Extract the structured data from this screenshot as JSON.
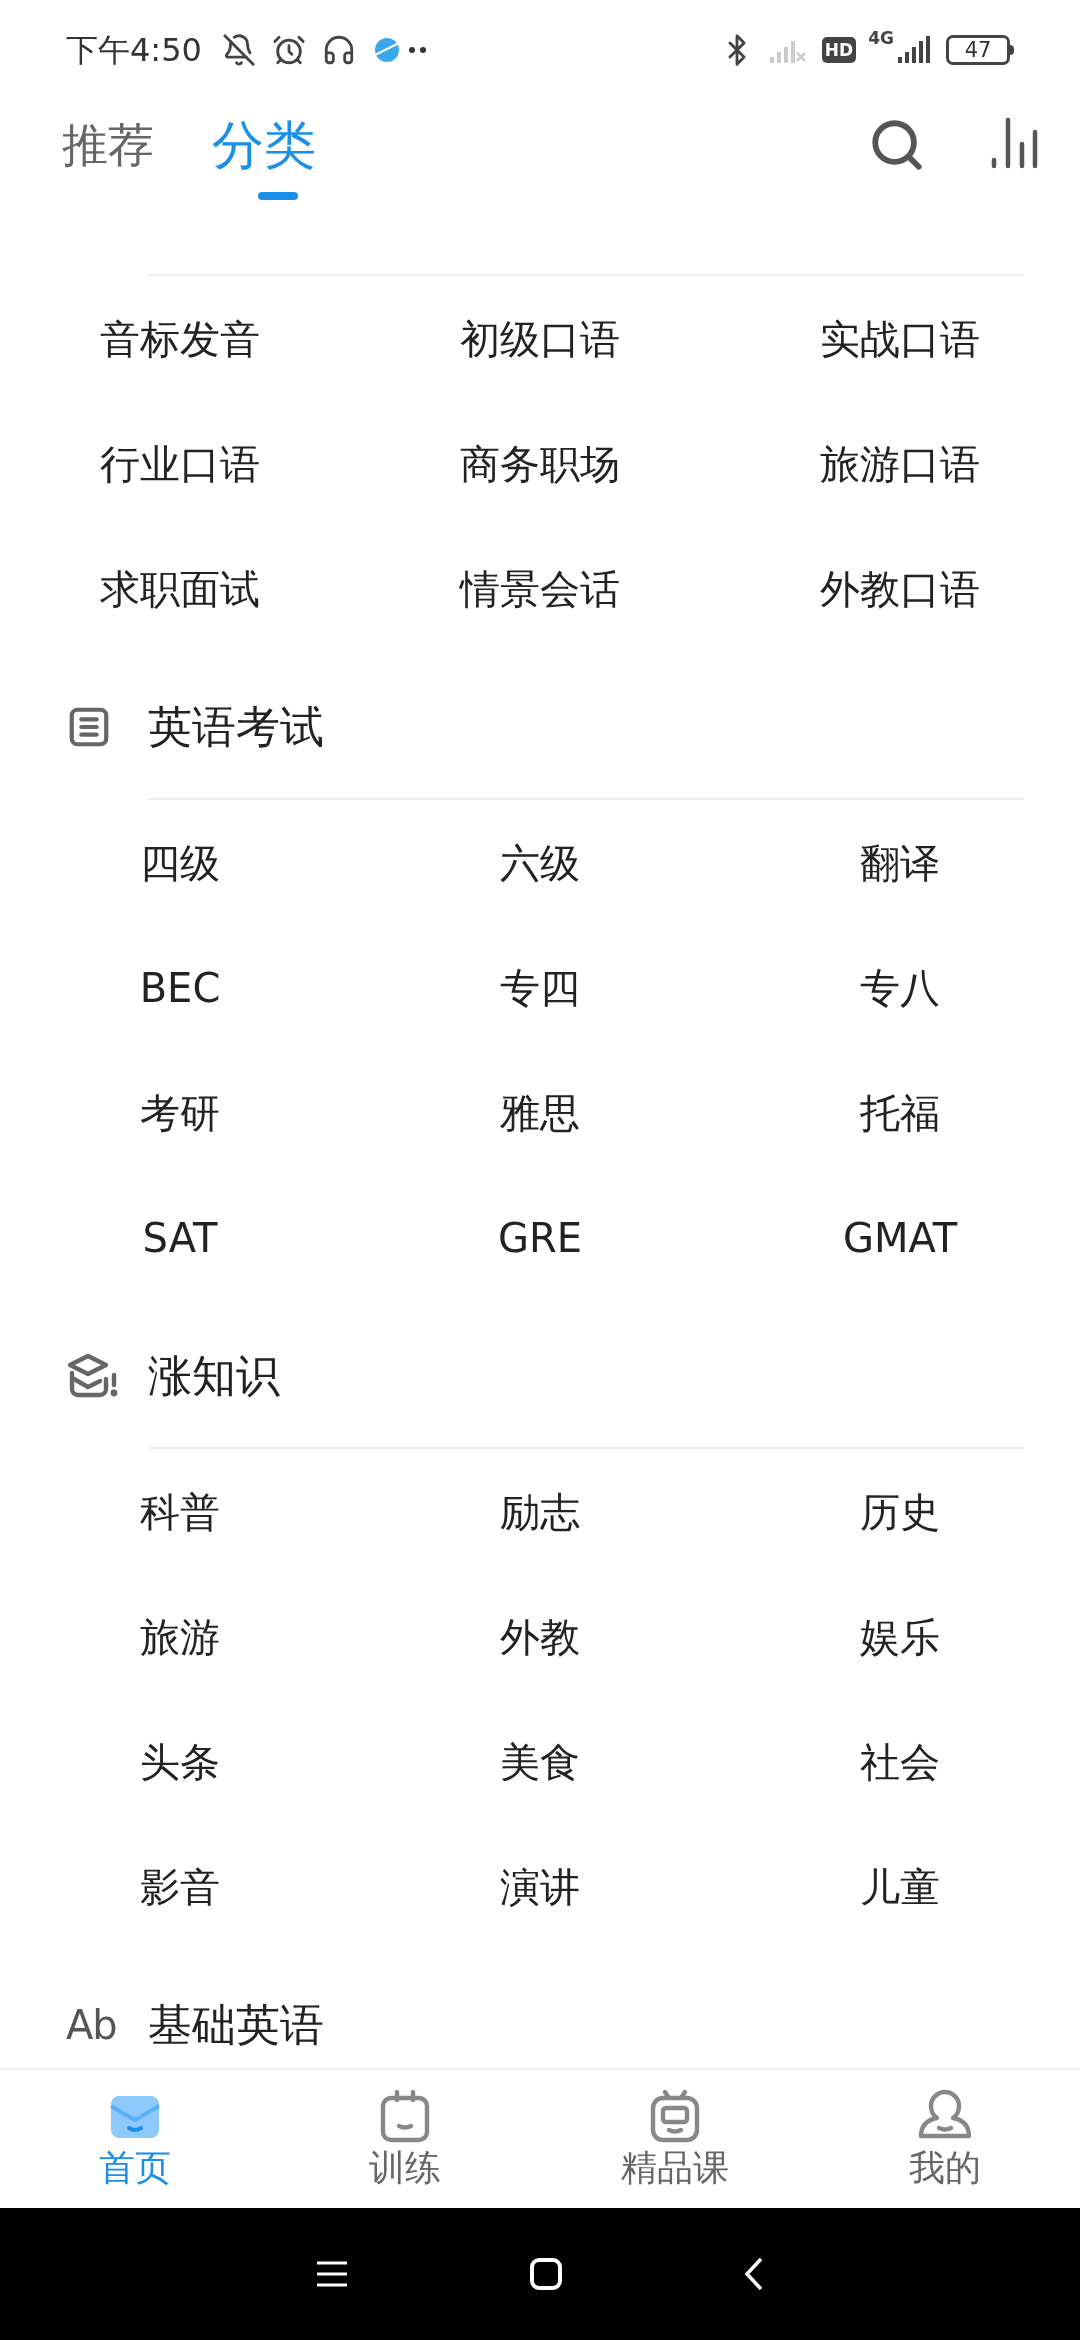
{
  "status_bar": {
    "time": "下午4:50",
    "hd": "HD",
    "network": "4G",
    "battery": "47"
  },
  "tabs": [
    {
      "label": "推荐",
      "selected": false
    },
    {
      "label": "分类",
      "selected": true
    }
  ],
  "sections": [
    {
      "items": [
        "音标发音",
        "初级口语",
        "实战口语",
        "行业口语",
        "商务职场",
        "旅游口语",
        "求职面试",
        "情景会话",
        "外教口语"
      ]
    },
    {
      "kind": "exam",
      "title": "英语考试",
      "items": [
        "四级",
        "六级",
        "翻译",
        "BEC",
        "专四",
        "专八",
        "考研",
        "雅思",
        "托福",
        "SAT",
        "GRE",
        "GMAT"
      ]
    },
    {
      "kind": "knowledge",
      "title": "涨知识",
      "items": [
        "科普",
        "励志",
        "历史",
        "旅游",
        "外教",
        "娱乐",
        "头条",
        "美食",
        "社会",
        "影音",
        "演讲",
        "儿童"
      ]
    },
    {
      "kind": "basics",
      "icon_text": "Ab",
      "title": "基础英语"
    }
  ],
  "nav": [
    {
      "label": "首页",
      "kind": "home",
      "selected": true
    },
    {
      "label": "训练",
      "kind": "train",
      "selected": false
    },
    {
      "label": "精品课",
      "kind": "course",
      "selected": false
    },
    {
      "label": "我的",
      "kind": "me",
      "selected": false
    }
  ]
}
